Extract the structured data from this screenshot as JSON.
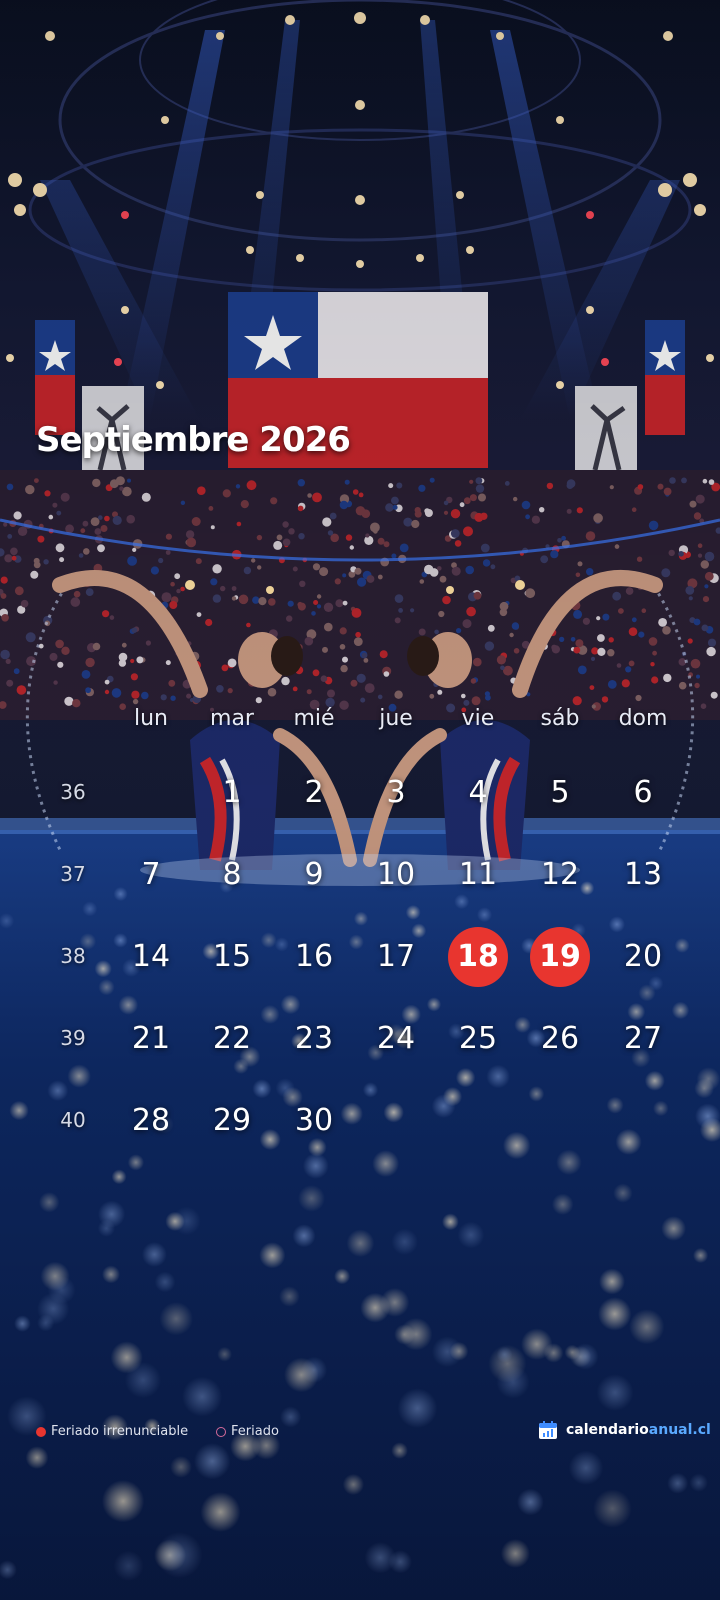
{
  "calendar": {
    "title": "Septiembre 2026",
    "weekday_labels": [
      "lun",
      "mar",
      "mié",
      "jue",
      "vie",
      "sáb",
      "dom"
    ],
    "weeks": [
      {
        "number": "36",
        "days": [
          "",
          "1",
          "2",
          "3",
          "4",
          "5",
          "6"
        ]
      },
      {
        "number": "37",
        "days": [
          "7",
          "8",
          "9",
          "10",
          "11",
          "12",
          "13"
        ]
      },
      {
        "number": "38",
        "days": [
          "14",
          "15",
          "16",
          "17",
          "18",
          "19",
          "20"
        ]
      },
      {
        "number": "39",
        "days": [
          "21",
          "22",
          "23",
          "24",
          "25",
          "26",
          "27"
        ]
      },
      {
        "number": "40",
        "days": [
          "28",
          "29",
          "30",
          "",
          "",
          "",
          ""
        ]
      }
    ],
    "highlighted_days": [
      "18",
      "19"
    ],
    "highlight_color": "#e8352f"
  },
  "legend": {
    "irrenunciable_label": "Feriado irrenunciable",
    "feriado_label": "Feriado"
  },
  "brand": {
    "name_part1": "calendario",
    "name_part2": "anual.cl",
    "icon": "calendar-chart-icon"
  },
  "background": {
    "scene": "synchronized-swimming-arena",
    "colors": {
      "sky": "#0a1024",
      "pool": "#0d2a66",
      "flag_red": "#c8262c",
      "flag_blue": "#1d3f8f"
    }
  }
}
